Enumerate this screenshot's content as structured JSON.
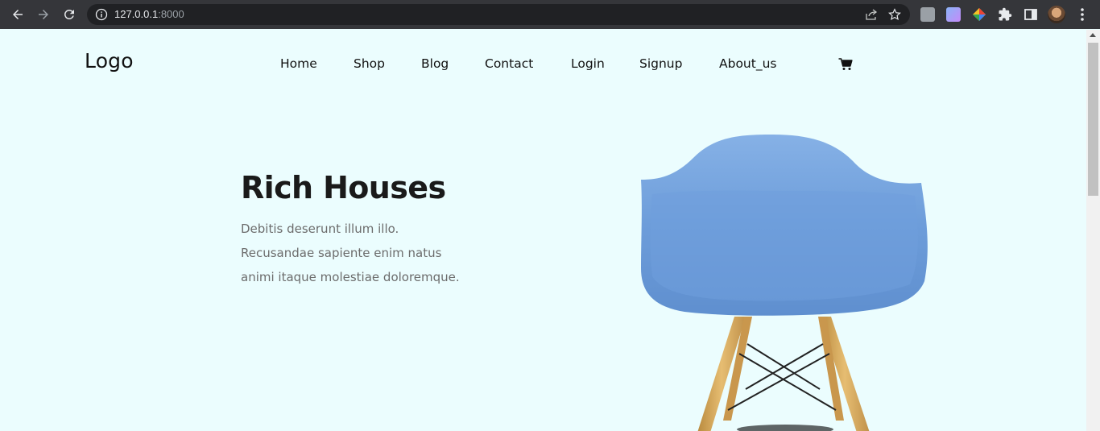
{
  "browser": {
    "url_host": "127.0.0.1",
    "url_port": ":8000"
  },
  "site": {
    "logo": "Logo",
    "nav": [
      {
        "label": "Home"
      },
      {
        "label": "Shop"
      },
      {
        "label": "Blog"
      },
      {
        "label": "Contact"
      },
      {
        "label": "Login"
      },
      {
        "label": "Signup"
      },
      {
        "label": "About_us"
      }
    ],
    "cart_icon": "shopping-cart-icon"
  },
  "hero": {
    "title": "Rich Houses",
    "lines": [
      "Debitis deserunt illum illo.",
      "Recusandae sapiente enim natus",
      "animi itaque molestiae doloremque."
    ],
    "image": "blue-chair-image"
  },
  "colors": {
    "page_background": "#ebfdfe",
    "chrome_background": "#35363a",
    "chair_seat": "#6f9fdc",
    "chair_legs": "#d7a85a"
  }
}
